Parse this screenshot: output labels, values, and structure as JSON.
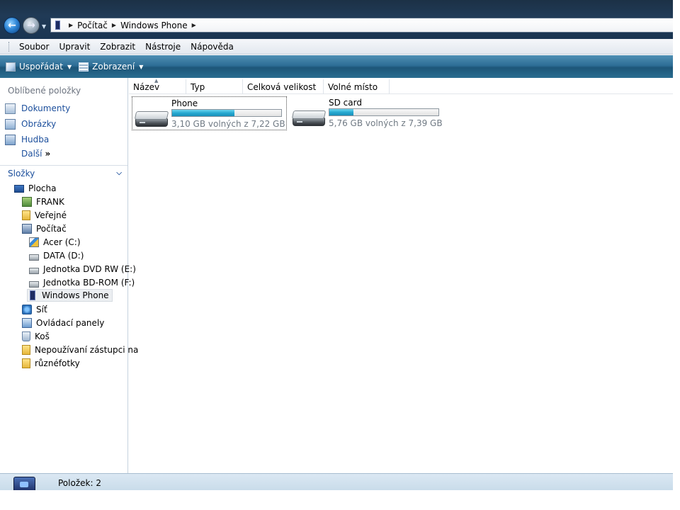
{
  "address": {
    "crumbs": [
      "Počítač",
      "Windows Phone"
    ]
  },
  "menu": [
    "Soubor",
    "Upravit",
    "Zobrazit",
    "Nástroje",
    "Nápověda"
  ],
  "toolbar": {
    "organize": "Uspořádat",
    "views": "Zobrazení"
  },
  "favorites": {
    "title": "Oblíbené položky",
    "items": [
      "Dokumenty",
      "Obrázky",
      "Hudba"
    ],
    "more": "Další",
    "more_glyph": "»"
  },
  "folders": {
    "title": "Složky",
    "tree": [
      {
        "label": "Plocha",
        "icon": "desktop-icon"
      },
      {
        "label": "FRANK",
        "icon": "user-folder-icon"
      },
      {
        "label": "Veřejné",
        "icon": "folder-icon"
      },
      {
        "label": "Počítač",
        "icon": "computer-icon"
      },
      {
        "label": "Acer (C:)",
        "icon": "windows-drive-icon"
      },
      {
        "label": "DATA (D:)",
        "icon": "drive-icon"
      },
      {
        "label": "Jednotka DVD RW (E:)",
        "icon": "dvd-drive-icon"
      },
      {
        "label": "Jednotka BD-ROM (F:)",
        "icon": "bd-drive-icon"
      },
      {
        "label": "Windows Phone",
        "icon": "phone-icon"
      },
      {
        "label": "Síť",
        "icon": "network-icon"
      },
      {
        "label": "Ovládací panely",
        "icon": "control-panel-icon"
      },
      {
        "label": "Koš",
        "icon": "recycle-bin-icon"
      },
      {
        "label": "Nepoužívaní zástupci na",
        "icon": "folder-icon"
      },
      {
        "label": "různéfotky",
        "icon": "folder-icon"
      }
    ]
  },
  "columns": [
    "Název",
    "Typ",
    "Celková velikost",
    "Volné místo"
  ],
  "drives": [
    {
      "name": "Phone",
      "free_text": "3,10 GB volných z 7,22 GB",
      "used_fraction": 0.57
    },
    {
      "name": "SD card",
      "free_text": "5,76 GB volných z 7,39 GB",
      "used_fraction": 0.22
    }
  ],
  "status": {
    "items": "Položek: 2"
  }
}
